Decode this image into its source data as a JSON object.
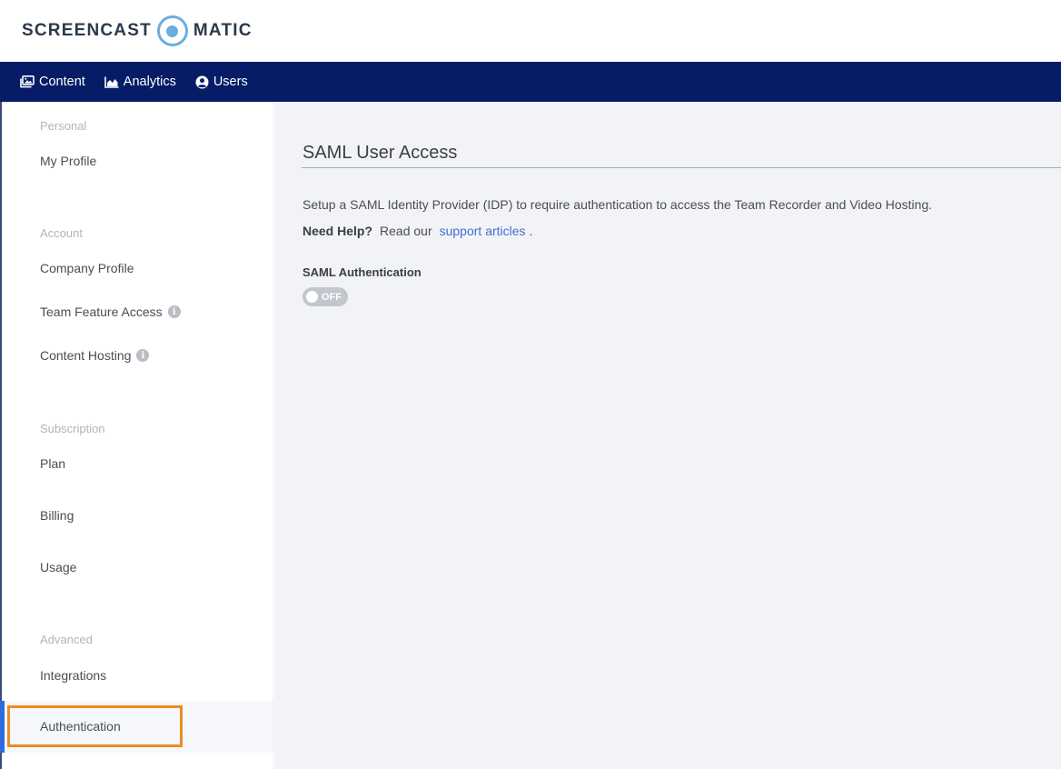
{
  "brand": {
    "left_text": "SCREENCAST",
    "right_text": "MATIC",
    "accent_color": "#6aaee0",
    "nav_color": "#061c66"
  },
  "topnav": {
    "items": [
      {
        "label": "Content",
        "icon": "image-gallery-icon"
      },
      {
        "label": "Analytics",
        "icon": "area-chart-icon"
      },
      {
        "label": "Users",
        "icon": "user-circle-icon"
      }
    ]
  },
  "sidebar": {
    "sections": [
      {
        "title": "Personal",
        "items": [
          "My Profile"
        ]
      },
      {
        "title": "Account",
        "items": [
          "Company Profile",
          "Team Feature Access",
          "Content Hosting"
        ]
      },
      {
        "title": "Subscription",
        "items": [
          "Plan",
          "Billing",
          "Usage"
        ]
      },
      {
        "title": "Advanced",
        "items": [
          "Integrations",
          "Authentication"
        ]
      }
    ],
    "active_item": "Authentication",
    "highlight_color": "#f08a24"
  },
  "main": {
    "title": "SAML User Access",
    "description": "Setup a SAML Identity Provider (IDP) to require authentication to access the Team Recorder and Video Hosting.",
    "help_label": "Need Help?",
    "help_prefix": "Read our",
    "help_link": "support articles",
    "help_suffix": ".",
    "field_label": "SAML Authentication",
    "toggle_state": "OFF"
  }
}
